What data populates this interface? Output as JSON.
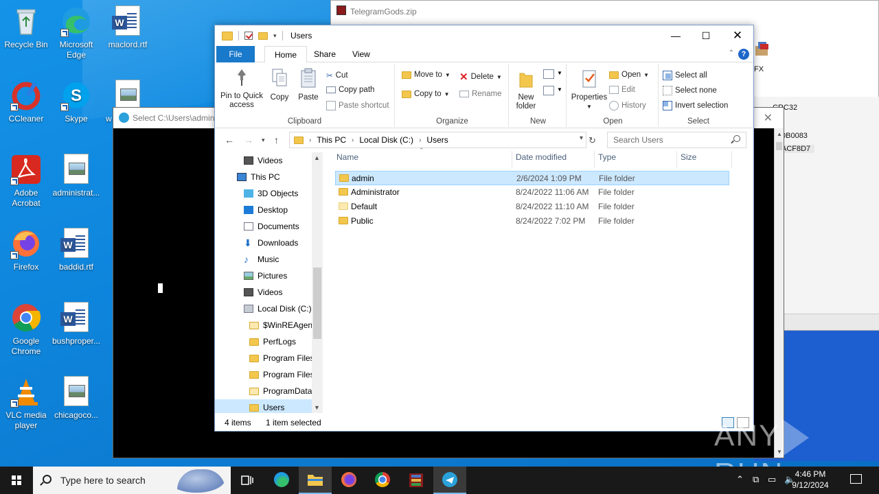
{
  "desktop": {
    "icons": [
      {
        "label": "Recycle Bin"
      },
      {
        "label": "Microsoft Edge"
      },
      {
        "label": "maclord.rtf"
      },
      {
        "label": "CCleaner"
      },
      {
        "label": "Skype"
      },
      {
        "label": "w"
      },
      {
        "label": "Adobe Acrobat"
      },
      {
        "label": "administrat..."
      },
      {
        "label": "Firefox"
      },
      {
        "label": "baddid.rtf"
      },
      {
        "label": "Google Chrome"
      },
      {
        "label": "bushproper..."
      },
      {
        "label": "VLC media player"
      },
      {
        "label": "chicagoco..."
      }
    ]
  },
  "winrar": {
    "title": "TelegramGods.zip",
    "fx": "FX",
    "crc_header": "CRC32",
    "crc1": "0B0083",
    "crc2": "ACF8D7"
  },
  "telegram_dialog": {
    "title": "Select C:\\Users\\admin\\"
  },
  "explorer": {
    "title": "Users",
    "tabs": {
      "file": "File",
      "home": "Home",
      "share": "Share",
      "view": "View"
    },
    "ribbon": {
      "clipboard": {
        "label": "Clipboard",
        "pin": "Pin to Quick access",
        "copy": "Copy",
        "paste": "Paste",
        "cut": "Cut",
        "copy_path": "Copy path",
        "paste_shortcut": "Paste shortcut"
      },
      "organize": {
        "label": "Organize",
        "move_to": "Move to",
        "copy_to": "Copy to",
        "delete": "Delete",
        "rename": "Rename"
      },
      "new": {
        "label": "New",
        "new_folder": "New folder"
      },
      "open": {
        "label": "Open",
        "properties": "Properties",
        "open": "Open",
        "edit": "Edit",
        "history": "History"
      },
      "select": {
        "label": "Select",
        "select_all": "Select all",
        "select_none": "Select none",
        "invert": "Invert selection"
      }
    },
    "address": {
      "crumbs": [
        "This PC",
        "Local Disk (C:)",
        "Users"
      ],
      "search_placeholder": "Search Users"
    },
    "nav": [
      {
        "label": "Videos"
      },
      {
        "label": "This PC"
      },
      {
        "label": "3D Objects"
      },
      {
        "label": "Desktop"
      },
      {
        "label": "Documents"
      },
      {
        "label": "Downloads"
      },
      {
        "label": "Music"
      },
      {
        "label": "Pictures"
      },
      {
        "label": "Videos"
      },
      {
        "label": "Local Disk (C:)"
      },
      {
        "label": "$WinREAgent"
      },
      {
        "label": "PerfLogs"
      },
      {
        "label": "Program Files"
      },
      {
        "label": "Program Files"
      },
      {
        "label": "ProgramData"
      },
      {
        "label": "Users"
      }
    ],
    "columns": {
      "name": "Name",
      "date": "Date modified",
      "type": "Type",
      "size": "Size"
    },
    "files": [
      {
        "name": "admin",
        "date": "2/6/2024 1:09 PM",
        "type": "File folder"
      },
      {
        "name": "Administrator",
        "date": "8/24/2022 11:06 AM",
        "type": "File folder"
      },
      {
        "name": "Default",
        "date": "8/24/2022 11:10 AM",
        "type": "File folder"
      },
      {
        "name": "Public",
        "date": "8/24/2022 7:02 PM",
        "type": "File folder"
      }
    ],
    "status": {
      "count": "4 items",
      "selected": "1 item selected"
    }
  },
  "watermark": {
    "left": "ANY",
    "right": "RUN"
  },
  "taskbar": {
    "search_placeholder": "Type here to search",
    "time": "4:46 PM",
    "date": "9/12/2024"
  }
}
